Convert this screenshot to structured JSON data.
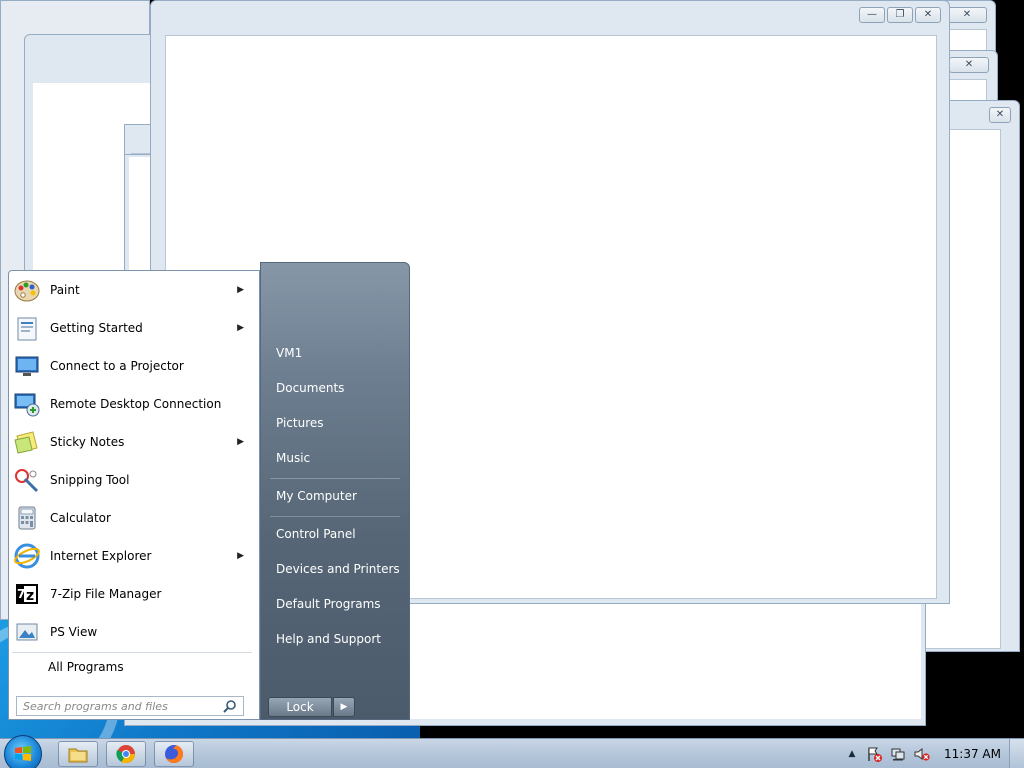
{
  "start_menu": {
    "programs": [
      {
        "label": "Paint",
        "icon": "paint-icon",
        "has_submenu": true
      },
      {
        "label": "Getting Started",
        "icon": "getting-started-icon",
        "has_submenu": true
      },
      {
        "label": "Connect to a Projector",
        "icon": "projector-icon",
        "has_submenu": false
      },
      {
        "label": "Remote Desktop Connection",
        "icon": "remote-desktop-icon",
        "has_submenu": false
      },
      {
        "label": "Sticky Notes",
        "icon": "sticky-notes-icon",
        "has_submenu": true
      },
      {
        "label": "Snipping Tool",
        "icon": "snipping-tool-icon",
        "has_submenu": false
      },
      {
        "label": "Calculator",
        "icon": "calculator-icon",
        "has_submenu": false
      },
      {
        "label": "Internet Explorer",
        "icon": "internet-explorer-icon",
        "has_submenu": true
      },
      {
        "label": "7-Zip File Manager",
        "icon": "7zip-icon",
        "has_submenu": false
      },
      {
        "label": "PS View",
        "icon": "ps-view-icon",
        "has_submenu": false
      }
    ],
    "all_programs_label": "All Programs",
    "search_placeholder": "Search programs and files",
    "places": [
      {
        "label": "VM1"
      },
      {
        "label": "Documents"
      },
      {
        "label": "Pictures"
      },
      {
        "label": "Music"
      },
      {
        "label": "My Computer"
      },
      {
        "label": "Control Panel"
      },
      {
        "label": "Devices and Printers"
      },
      {
        "label": "Default Programs"
      },
      {
        "label": "Help and Support"
      }
    ],
    "lock_label": "Lock"
  },
  "window": {
    "minimize_glyph": "—",
    "restore_glyph": "❐",
    "close_glyph": "✕"
  },
  "taskbar": {
    "pinned": [
      {
        "name": "windows-explorer-icon"
      },
      {
        "name": "chrome-icon"
      },
      {
        "name": "firefox-icon"
      }
    ],
    "clock": "11:37 AM",
    "tray_arrow": "▲"
  },
  "colors": {
    "start_right_top": "#8697a8",
    "start_right_bottom": "#4c5b6b",
    "taskbar": "#b4c6da"
  }
}
